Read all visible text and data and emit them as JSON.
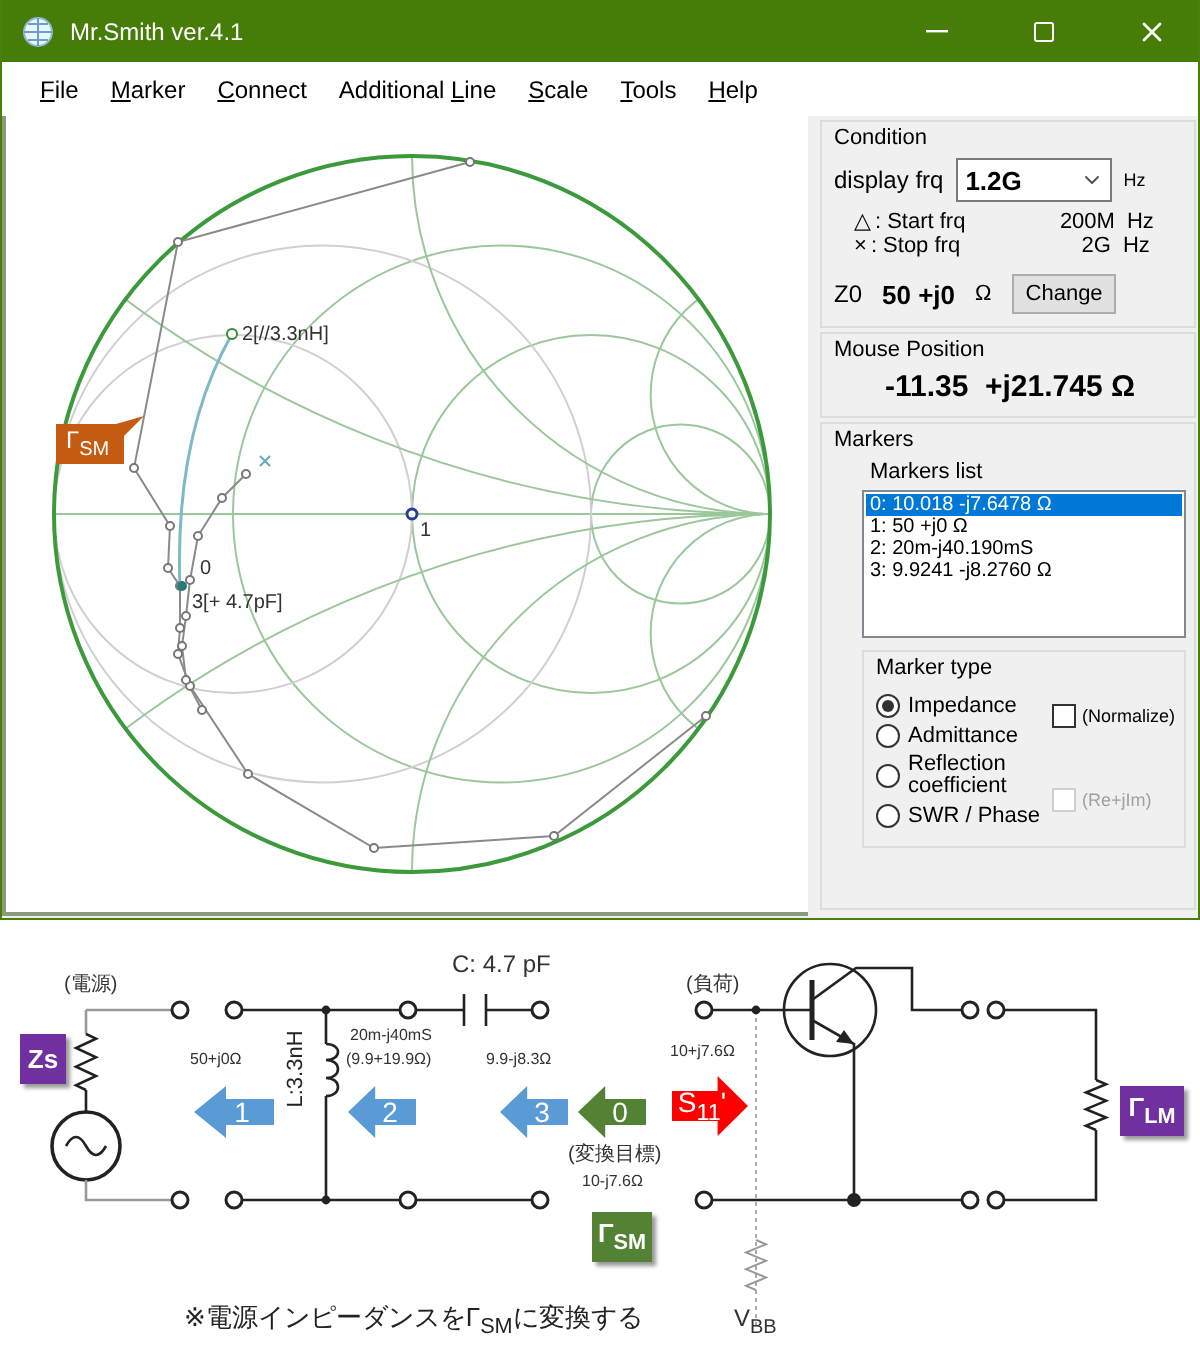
{
  "window": {
    "title": "Mr.Smith ver.4.1"
  },
  "menu": [
    {
      "key": "F",
      "post": "ile"
    },
    {
      "key": "M",
      "post": "arker"
    },
    {
      "key": "C",
      "post": "onnect"
    },
    {
      "pre": "Additional ",
      "key": "L",
      "post": "ine"
    },
    {
      "key": "S",
      "post": "cale"
    },
    {
      "key": "T",
      "post": "ools"
    },
    {
      "key": "H",
      "post": "elp"
    }
  ],
  "chart": {
    "callout": "Γ$_{SM}$",
    "marker_labels": [
      {
        "text": "2[//3.3nH]"
      },
      {
        "text": "1"
      },
      {
        "text": "0"
      },
      {
        "text": "3[+ 4.7pF]"
      }
    ]
  },
  "condition": {
    "title": "Condition",
    "display_label": "display frq",
    "display_value": "1.2G",
    "display_unit": "Hz",
    "rows": [
      {
        "symbol": "△",
        "label": ": Start frq",
        "value": "200M",
        "unit": "Hz"
      },
      {
        "symbol": "×",
        "label": ": Stop frq",
        "value": "2G",
        "unit": "Hz"
      }
    ],
    "z0_label": "Z0",
    "z0_value": "50 +j0",
    "z0_unit": "Ω",
    "button": "Change"
  },
  "mouse_position": {
    "title": "Mouse Position",
    "value": "-11.35  +j21.745 Ω"
  },
  "markers": {
    "title": "Markers",
    "list_title": "Markers list",
    "items": [
      {
        "text": "0: 10.018 -j7.6478 Ω",
        "selected": true
      },
      {
        "text": "1: 50 +j0 Ω",
        "selected": false
      },
      {
        "text": "2: 20m-j40.190mS",
        "selected": false
      },
      {
        "text": "3: 9.9241 -j8.2760 Ω",
        "selected": false
      }
    ],
    "type_title": "Marker type",
    "options": [
      {
        "label": "Impedance",
        "selected": true
      },
      {
        "label": "Admittance",
        "selected": false
      },
      {
        "label": "Reflection coefficient",
        "selected": false
      },
      {
        "label": "SWR / Phase",
        "selected": false
      }
    ],
    "checkboxes": [
      {
        "label": "(Normalize)",
        "checked": false,
        "disabled": false
      },
      {
        "label": "(Re+jIm)",
        "checked": false,
        "disabled": true
      }
    ]
  },
  "circuit": {
    "labels": [
      {
        "text": "(電源)"
      },
      {
        "text": "50+j0Ω"
      },
      {
        "text": "20m-j40mS"
      },
      {
        "text": "(9.9+19.9Ω)"
      },
      {
        "text": "9.9-j8.3Ω"
      },
      {
        "text": "C: 4.7 pF"
      },
      {
        "text": "(変換目標)"
      },
      {
        "text": "10-j7.6Ω"
      },
      {
        "text": "(負荷)"
      },
      {
        "text": "10+j7.6Ω"
      },
      {
        "text": "V$_{BB}$"
      }
    ],
    "inductor_label": "L:3.3nH",
    "arrows": [
      {
        "label": "1",
        "kind": "left",
        "color": "#5b9bd5"
      },
      {
        "label": "2",
        "kind": "left",
        "color": "#5b9bd5"
      },
      {
        "label": "3",
        "kind": "left",
        "color": "#5b9bd5"
      },
      {
        "label": "0",
        "kind": "left",
        "color": "#548235"
      },
      {
        "label": "S$_{11}$'",
        "kind": "right",
        "color": "#ff0000"
      }
    ],
    "badges": [
      {
        "text": "Zs",
        "color": "#7030a0"
      },
      {
        "text": "Γ$_{SM}$",
        "color": "#548235"
      },
      {
        "text": "Γ$_{LM}$",
        "color": "#7030a0"
      }
    ],
    "note": "※電源インピーダンスをΓ$_{SM}$に変換する"
  }
}
